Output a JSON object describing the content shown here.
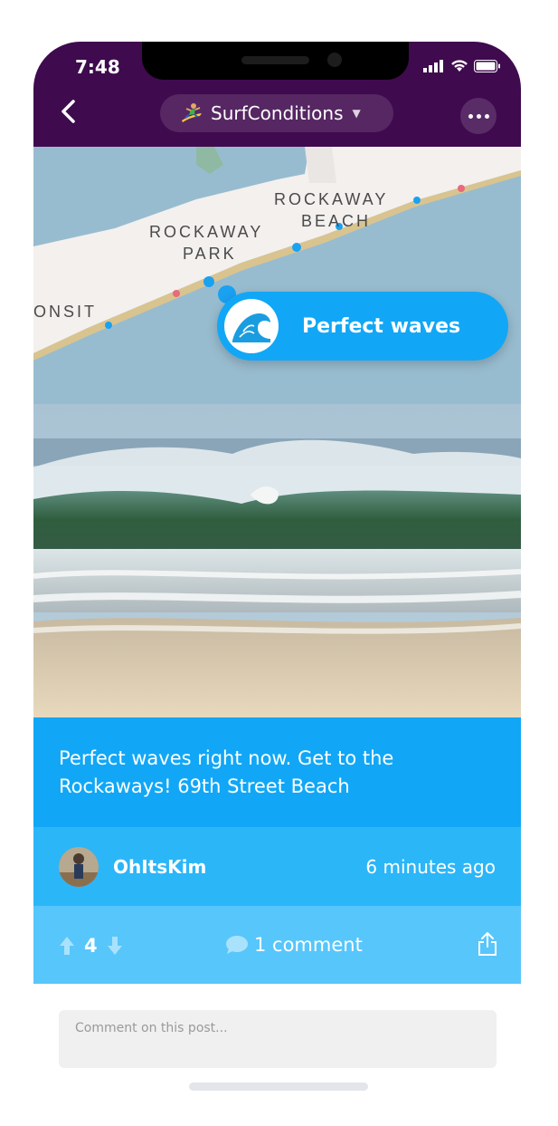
{
  "status": {
    "time": "7:48"
  },
  "header": {
    "channel": "SurfConditions",
    "caret": "▼"
  },
  "map": {
    "labels": {
      "rockaway_beach_1": "ROCKAWAY",
      "rockaway_beach_2": "BEACH",
      "rockaway_park_1": "ROCKAWAY",
      "rockaway_park_2": "PARK",
      "onsit": "ONSIT"
    },
    "badge": "Perfect waves"
  },
  "post": {
    "text": "Perfect waves right now. Get to the Rockaways! 69th Street Beach",
    "author": "OhItsKim",
    "time_ago": "6 minutes ago",
    "score": "4",
    "comments": "1 comment"
  },
  "comment_box": {
    "placeholder": "Comment on this post..."
  },
  "colors": {
    "topbar": "#3f0a4e",
    "accent": "#11a7f6",
    "author_bar": "#2bb6f8",
    "action_bar": "#57c6fb"
  },
  "icons": [
    "back-icon",
    "surfer-icon",
    "more-icon",
    "wave-icon",
    "upvote-icon",
    "downvote-icon",
    "comment-icon",
    "share-icon"
  ]
}
